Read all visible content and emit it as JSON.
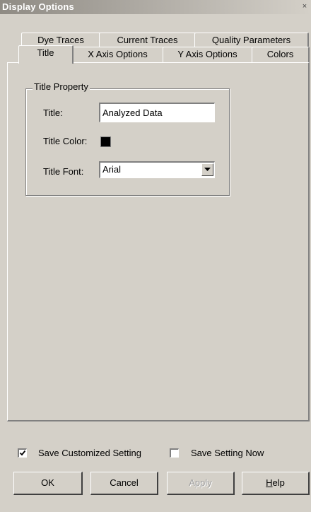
{
  "window": {
    "title": "Display Options",
    "close_glyph": "×"
  },
  "tabs": {
    "row1": [
      "Dye Traces",
      "Current Traces",
      "Quality Parameters"
    ],
    "row2": [
      "Title",
      "X Axis Options",
      "Y Axis Options",
      "Colors"
    ],
    "active": "Title"
  },
  "title_property": {
    "legend": "Title Property",
    "title_label": "Title:",
    "title_value": "Analyzed Data",
    "color_label": "Title Color:",
    "color_value": "#000000",
    "font_label": "Title Font:",
    "font_value": "Arial"
  },
  "footer": {
    "save_customized": {
      "label": "Save Customized Setting",
      "checked": true
    },
    "save_now": {
      "label": "Save Setting Now",
      "checked": false
    }
  },
  "buttons": {
    "ok": "OK",
    "cancel": "Cancel",
    "apply": "Apply",
    "help_first": "H",
    "help_rest": "elp"
  }
}
